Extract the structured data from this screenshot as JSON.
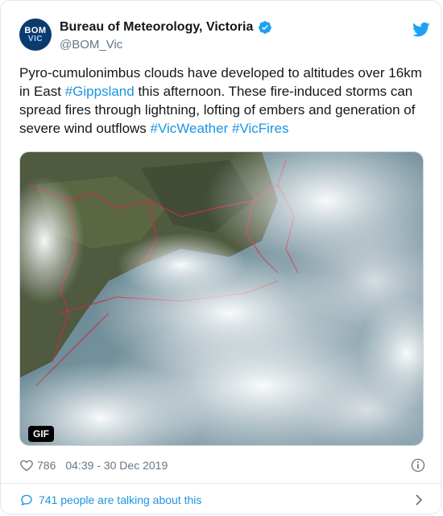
{
  "author": {
    "avatar_line1": "BOM",
    "avatar_line2": "VIC",
    "display_name": "Bureau of Meteorology, Victoria",
    "handle": "@BOM_Vic",
    "verified": true
  },
  "tweet": {
    "text_part1": "Pyro-cumulonimbus clouds have developed to altitudes over 16km in East ",
    "hashtag1": "#Gippsland",
    "text_part2": " this afternoon. These fire-induced storms can spread fires through lightning, lofting of embers and generation of severe wind outflows ",
    "hashtag2": "#VicWeather",
    "text_part3": " ",
    "hashtag3": "#VicFires"
  },
  "media": {
    "badge": "GIF"
  },
  "meta": {
    "likes": "786",
    "timestamp": "04:39 - 30 Dec 2019"
  },
  "footer": {
    "conversation": "741 people are talking about this"
  },
  "colors": {
    "link": "#1b95e0",
    "verified": "#1da1f2",
    "avatar_bg": "#0b3a6f"
  }
}
